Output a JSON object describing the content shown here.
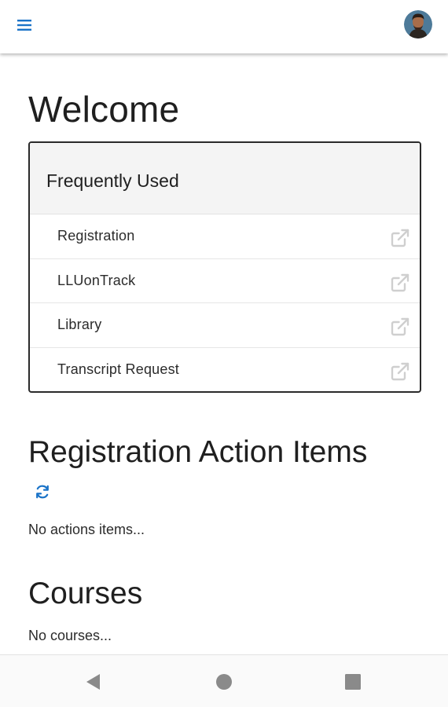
{
  "topbar": {
    "menu_icon": "hamburger-menu-icon",
    "avatar_icon": "user-avatar",
    "accent_color": "#1a73c8"
  },
  "welcome": {
    "title": "Welcome"
  },
  "frequently_used": {
    "title": "Frequently Used",
    "links": [
      {
        "label": "Registration",
        "icon": "external-link-icon"
      },
      {
        "label": "LLUonTrack",
        "icon": "external-link-icon"
      },
      {
        "label": "Library",
        "icon": "external-link-icon"
      },
      {
        "label": "Transcript Request",
        "icon": "external-link-icon"
      }
    ]
  },
  "registration_action_items": {
    "title": "Registration Action Items",
    "refresh_icon": "refresh-icon",
    "empty_text": "No actions items..."
  },
  "courses": {
    "title": "Courses",
    "empty_text": "No courses..."
  },
  "navbar": {
    "back_icon": "back-triangle-icon",
    "home_icon": "home-circle-icon",
    "recent_icon": "recent-apps-square-icon"
  }
}
